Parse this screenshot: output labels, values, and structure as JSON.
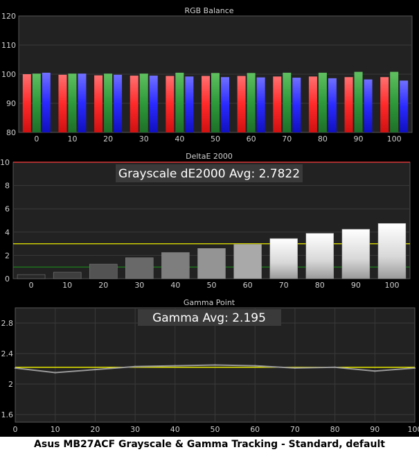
{
  "caption": "Asus MB27ACF Grayscale & Gamma Tracking - Standard, default",
  "colors": {
    "background": "#000000",
    "plot_background": "#222222",
    "grid": "#3a3a3a",
    "axis_text": "#d0d0d0",
    "red": "#ff3333",
    "green": "#33a040",
    "blue": "#3333ff",
    "threshold_red": "#ff4040",
    "threshold_yellow": "#e8e800",
    "threshold_green": "#1a8a1a",
    "gamma_line": "#9a9a9a",
    "gamma_target": "#e8e800"
  },
  "chart_data": [
    {
      "type": "bar",
      "title": "RGB Balance",
      "categories": [
        "0",
        "10",
        "20",
        "30",
        "40",
        "50",
        "60",
        "70",
        "80",
        "90",
        "100"
      ],
      "ylim": [
        80,
        120
      ],
      "yticks": [
        80,
        90,
        100,
        110,
        120
      ],
      "series": [
        {
          "color": "red",
          "values": [
            100,
            99.8,
            99.6,
            99.5,
            99.4,
            99.4,
            99.4,
            99.2,
            99.2,
            99.0,
            99.0
          ]
        },
        {
          "color": "green",
          "values": [
            100.2,
            100.2,
            100.2,
            100.2,
            100.5,
            100.4,
            100.4,
            100.5,
            100.5,
            100.8,
            100.8
          ]
        },
        {
          "color": "blue",
          "values": [
            100.5,
            100.2,
            99.8,
            99.5,
            99.2,
            99.0,
            98.9,
            98.8,
            98.6,
            98.2,
            97.8
          ]
        }
      ]
    },
    {
      "type": "bar",
      "title": "DeltaE 2000",
      "annotation": "Grayscale dE2000 Avg: 2.7822",
      "categories": [
        "0",
        "10",
        "20",
        "30",
        "40",
        "50",
        "60",
        "70",
        "80",
        "90",
        "100"
      ],
      "values": [
        0.35,
        0.55,
        1.25,
        1.8,
        2.25,
        2.6,
        2.95,
        3.45,
        3.9,
        4.25,
        4.75
      ],
      "ylim": [
        0,
        10
      ],
      "yticks": [
        0,
        2,
        4,
        6,
        8,
        10
      ],
      "thresholds": [
        {
          "value": 10,
          "color": "red"
        },
        {
          "value": 3,
          "color": "yellow"
        },
        {
          "value": 1,
          "color": "green"
        }
      ]
    },
    {
      "type": "line",
      "title": "Gamma Point",
      "annotation": "Gamma Avg: 2.195",
      "x": [
        0,
        10,
        20,
        30,
        40,
        50,
        60,
        70,
        80,
        90,
        100
      ],
      "y": [
        2.21,
        2.15,
        2.19,
        2.23,
        2.24,
        2.25,
        2.24,
        2.21,
        2.22,
        2.17,
        2.21
      ],
      "target": 2.22,
      "ylim": [
        1.5,
        3.0
      ],
      "yticks": [
        1.6,
        2,
        2.4,
        2.8
      ],
      "xlim": [
        0,
        100
      ],
      "xticks": [
        "0",
        "10",
        "20",
        "30",
        "40",
        "50",
        "60",
        "70",
        "80",
        "90",
        "100"
      ]
    }
  ]
}
